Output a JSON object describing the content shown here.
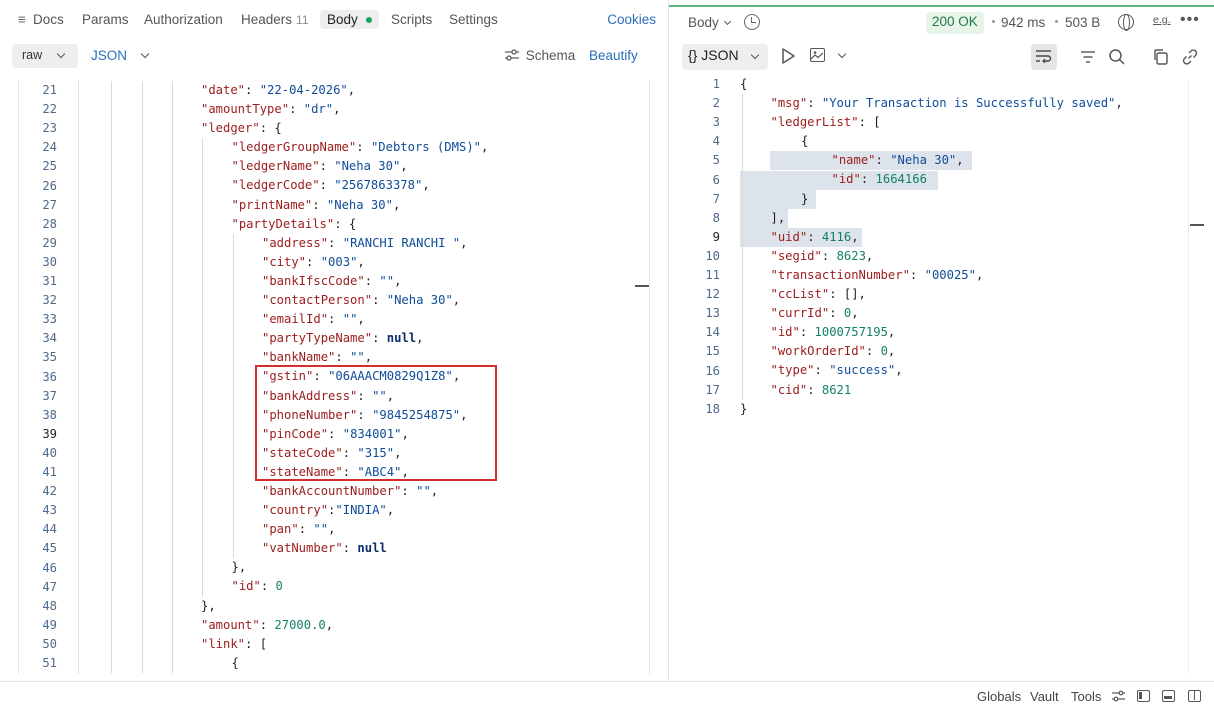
{
  "request_tabs": {
    "docs": "Docs",
    "params": "Params",
    "authorization": "Authorization",
    "headers": "Headers",
    "headers_count": "11",
    "body": "Body",
    "scripts": "Scripts",
    "settings": "Settings",
    "cookies": "Cookies"
  },
  "body_bar": {
    "mode": "raw",
    "format": "JSON",
    "schema": "Schema",
    "beautify": "Beautify"
  },
  "request_editor": {
    "lines": [
      {
        "n": "21",
        "indent": 4,
        "tokens": [
          [
            "k",
            "\"date\""
          ],
          [
            "p",
            ": "
          ],
          [
            "s",
            "\"22-04-2026\""
          ],
          [
            "p",
            ","
          ]
        ]
      },
      {
        "n": "22",
        "indent": 4,
        "tokens": [
          [
            "k",
            "\"amountType\""
          ],
          [
            "p",
            ": "
          ],
          [
            "s",
            "\"dr\""
          ],
          [
            "p",
            ","
          ]
        ]
      },
      {
        "n": "23",
        "indent": 4,
        "tokens": [
          [
            "k",
            "\"ledger\""
          ],
          [
            "p",
            ": {"
          ]
        ]
      },
      {
        "n": "24",
        "indent": 5,
        "tokens": [
          [
            "k",
            "\"ledgerGroupName\""
          ],
          [
            "p",
            ": "
          ],
          [
            "s",
            "\"Debtors (DMS)\""
          ],
          [
            "p",
            ","
          ]
        ]
      },
      {
        "n": "25",
        "indent": 5,
        "tokens": [
          [
            "k",
            "\"ledgerName\""
          ],
          [
            "p",
            ": "
          ],
          [
            "s",
            "\"Neha 30\""
          ],
          [
            "p",
            ","
          ]
        ]
      },
      {
        "n": "26",
        "indent": 5,
        "tokens": [
          [
            "k",
            "\"ledgerCode\""
          ],
          [
            "p",
            ": "
          ],
          [
            "s",
            "\"2567863378\""
          ],
          [
            "p",
            ","
          ]
        ]
      },
      {
        "n": "27",
        "indent": 5,
        "tokens": [
          [
            "k",
            "\"printName\""
          ],
          [
            "p",
            ": "
          ],
          [
            "s",
            "\"Neha 30\""
          ],
          [
            "p",
            ","
          ]
        ]
      },
      {
        "n": "28",
        "indent": 5,
        "tokens": [
          [
            "k",
            "\"partyDetails\""
          ],
          [
            "p",
            ": {"
          ]
        ]
      },
      {
        "n": "29",
        "indent": 6,
        "tokens": [
          [
            "k",
            "\"address\""
          ],
          [
            "p",
            ": "
          ],
          [
            "s",
            "\"RANCHI RANCHI \""
          ],
          [
            "p",
            ","
          ]
        ]
      },
      {
        "n": "30",
        "indent": 6,
        "tokens": [
          [
            "k",
            "\"city\""
          ],
          [
            "p",
            ": "
          ],
          [
            "s",
            "\"003\""
          ],
          [
            "p",
            ","
          ]
        ]
      },
      {
        "n": "31",
        "indent": 6,
        "tokens": [
          [
            "k",
            "\"bankIfscCode\""
          ],
          [
            "p",
            ": "
          ],
          [
            "s",
            "\"\""
          ],
          [
            "p",
            ","
          ]
        ]
      },
      {
        "n": "32",
        "indent": 6,
        "tokens": [
          [
            "k",
            "\"contactPerson\""
          ],
          [
            "p",
            ": "
          ],
          [
            "s",
            "\"Neha 30\""
          ],
          [
            "p",
            ","
          ]
        ]
      },
      {
        "n": "33",
        "indent": 6,
        "tokens": [
          [
            "k",
            "\"emailId\""
          ],
          [
            "p",
            ": "
          ],
          [
            "s",
            "\"\""
          ],
          [
            "p",
            ","
          ]
        ]
      },
      {
        "n": "34",
        "indent": 6,
        "tokens": [
          [
            "k",
            "\"partyTypeName\""
          ],
          [
            "p",
            ": "
          ],
          [
            "kw",
            "null"
          ],
          [
            "p",
            ","
          ]
        ]
      },
      {
        "n": "35",
        "indent": 6,
        "tokens": [
          [
            "k",
            "\"bankName\""
          ],
          [
            "p",
            ": "
          ],
          [
            "s",
            "\"\""
          ],
          [
            "p",
            ","
          ]
        ]
      },
      {
        "n": "36",
        "indent": 6,
        "tokens": [
          [
            "k",
            "\"gstin\""
          ],
          [
            "p",
            ": "
          ],
          [
            "s",
            "\"06AAACM0829Q1Z8\""
          ],
          [
            "p",
            ","
          ]
        ]
      },
      {
        "n": "37",
        "indent": 6,
        "tokens": [
          [
            "k",
            "\"bankAddress\""
          ],
          [
            "p",
            ": "
          ],
          [
            "s",
            "\"\""
          ],
          [
            "p",
            ","
          ]
        ]
      },
      {
        "n": "38",
        "indent": 6,
        "tokens": [
          [
            "k",
            "\"phoneNumber\""
          ],
          [
            "p",
            ": "
          ],
          [
            "s",
            "\"9845254875\""
          ],
          [
            "p",
            ","
          ]
        ]
      },
      {
        "n": "39",
        "indent": 6,
        "tokens": [
          [
            "k",
            "\"pinCode\""
          ],
          [
            "p",
            ": "
          ],
          [
            "s",
            "\"834001\""
          ],
          [
            "p",
            ","
          ]
        ]
      },
      {
        "n": "40",
        "indent": 6,
        "tokens": [
          [
            "k",
            "\"stateCode\""
          ],
          [
            "p",
            ": "
          ],
          [
            "s",
            "\"315\""
          ],
          [
            "p",
            ","
          ]
        ]
      },
      {
        "n": "41",
        "indent": 6,
        "tokens": [
          [
            "k",
            "\"stateName\""
          ],
          [
            "p",
            ": "
          ],
          [
            "s",
            "\"ABC4\""
          ],
          [
            "p",
            ","
          ]
        ]
      },
      {
        "n": "42",
        "indent": 6,
        "tokens": [
          [
            "k",
            "\"bankAccountNumber\""
          ],
          [
            "p",
            ": "
          ],
          [
            "s",
            "\"\""
          ],
          [
            "p",
            ","
          ]
        ]
      },
      {
        "n": "43",
        "indent": 6,
        "tokens": [
          [
            "k",
            "\"country\""
          ],
          [
            "p",
            ":"
          ],
          [
            "s",
            "\"INDIA\""
          ],
          [
            "p",
            ","
          ]
        ]
      },
      {
        "n": "44",
        "indent": 6,
        "tokens": [
          [
            "k",
            "\"pan\""
          ],
          [
            "p",
            ": "
          ],
          [
            "s",
            "\"\""
          ],
          [
            "p",
            ","
          ]
        ]
      },
      {
        "n": "45",
        "indent": 6,
        "tokens": [
          [
            "k",
            "\"vatNumber\""
          ],
          [
            "p",
            ": "
          ],
          [
            "kw",
            "null"
          ]
        ]
      },
      {
        "n": "46",
        "indent": 5,
        "tokens": [
          [
            "p",
            "},"
          ]
        ]
      },
      {
        "n": "47",
        "indent": 5,
        "tokens": [
          [
            "k",
            "\"id\""
          ],
          [
            "p",
            ": "
          ],
          [
            "n",
            "0"
          ]
        ]
      },
      {
        "n": "48",
        "indent": 4,
        "tokens": [
          [
            "p",
            "},"
          ]
        ]
      },
      {
        "n": "49",
        "indent": 4,
        "tokens": [
          [
            "k",
            "\"amount\""
          ],
          [
            "p",
            ": "
          ],
          [
            "n",
            "27000.0"
          ],
          [
            "p",
            ","
          ]
        ]
      },
      {
        "n": "50",
        "indent": 4,
        "tokens": [
          [
            "k",
            "\"link\""
          ],
          [
            "p",
            ": ["
          ]
        ]
      },
      {
        "n": "51",
        "indent": 5,
        "tokens": [
          [
            "p",
            "{"
          ]
        ]
      }
    ]
  },
  "response_bar": {
    "body_label": "Body",
    "status": "200 OK",
    "time": "942 ms",
    "size": "503 B",
    "format": "{} JSON",
    "example_icon_text": "e.g."
  },
  "response_editor": {
    "lines": [
      {
        "n": "1",
        "indent": 0,
        "tokens": [
          [
            "p",
            "{"
          ]
        ]
      },
      {
        "n": "2",
        "indent": 1,
        "tokens": [
          [
            "k",
            "\"msg\""
          ],
          [
            "p",
            ": "
          ],
          [
            "s",
            "\"Your Transaction is Successfully saved\""
          ],
          [
            "p",
            ","
          ]
        ]
      },
      {
        "n": "3",
        "indent": 1,
        "tokens": [
          [
            "k",
            "\"ledgerList\""
          ],
          [
            "p",
            ": ["
          ]
        ]
      },
      {
        "n": "4",
        "indent": 2,
        "tokens": [
          [
            "p",
            "{"
          ]
        ]
      },
      {
        "n": "5",
        "indent": 3,
        "tokens": [
          [
            "k",
            "\"name\""
          ],
          [
            "p",
            ": "
          ],
          [
            "s",
            "\"Neha 30\""
          ],
          [
            "p",
            ","
          ]
        ]
      },
      {
        "n": "6",
        "indent": 3,
        "tokens": [
          [
            "k",
            "\"id\""
          ],
          [
            "p",
            ": "
          ],
          [
            "n",
            "1664166"
          ]
        ]
      },
      {
        "n": "7",
        "indent": 2,
        "tokens": [
          [
            "p",
            "}"
          ]
        ]
      },
      {
        "n": "8",
        "indent": 1,
        "tokens": [
          [
            "p",
            "],"
          ]
        ]
      },
      {
        "n": "9",
        "indent": 1,
        "tokens": [
          [
            "k",
            "\"uid\""
          ],
          [
            "p",
            ": "
          ],
          [
            "n",
            "4116"
          ],
          [
            "p",
            ","
          ]
        ]
      },
      {
        "n": "10",
        "indent": 1,
        "tokens": [
          [
            "k",
            "\"segid\""
          ],
          [
            "p",
            ": "
          ],
          [
            "n",
            "8623"
          ],
          [
            "p",
            ","
          ]
        ]
      },
      {
        "n": "11",
        "indent": 1,
        "tokens": [
          [
            "k",
            "\"transactionNumber\""
          ],
          [
            "p",
            ": "
          ],
          [
            "s",
            "\"00025\""
          ],
          [
            "p",
            ","
          ]
        ]
      },
      {
        "n": "12",
        "indent": 1,
        "tokens": [
          [
            "k",
            "\"ccList\""
          ],
          [
            "p",
            ": [],"
          ]
        ]
      },
      {
        "n": "13",
        "indent": 1,
        "tokens": [
          [
            "k",
            "\"currId\""
          ],
          [
            "p",
            ": "
          ],
          [
            "n",
            "0"
          ],
          [
            "p",
            ","
          ]
        ]
      },
      {
        "n": "14",
        "indent": 1,
        "tokens": [
          [
            "k",
            "\"id\""
          ],
          [
            "p",
            ": "
          ],
          [
            "n",
            "1000757195"
          ],
          [
            "p",
            ","
          ]
        ]
      },
      {
        "n": "15",
        "indent": 1,
        "tokens": [
          [
            "k",
            "\"workOrderId\""
          ],
          [
            "p",
            ": "
          ],
          [
            "n",
            "0"
          ],
          [
            "p",
            ","
          ]
        ]
      },
      {
        "n": "16",
        "indent": 1,
        "tokens": [
          [
            "k",
            "\"type\""
          ],
          [
            "p",
            ": "
          ],
          [
            "s",
            "\"success\""
          ],
          [
            "p",
            ","
          ]
        ]
      },
      {
        "n": "17",
        "indent": 1,
        "tokens": [
          [
            "k",
            "\"cid\""
          ],
          [
            "p",
            ": "
          ],
          [
            "n",
            "8621"
          ]
        ]
      },
      {
        "n": "18",
        "indent": 0,
        "tokens": [
          [
            "p",
            "}"
          ]
        ]
      }
    ]
  },
  "footer": {
    "globals": "Globals",
    "vault": "Vault",
    "tools": "Tools"
  },
  "colors": {
    "accent": "#2a6ebb",
    "status_ok": "#1f7a43",
    "body_dot": "#19a35c",
    "highlight_box": "#d32f2f"
  }
}
